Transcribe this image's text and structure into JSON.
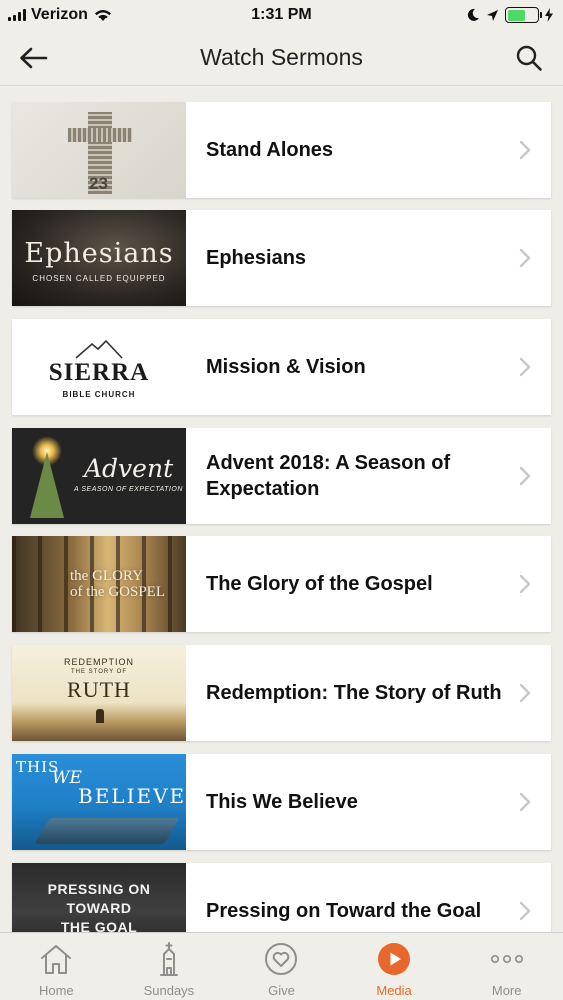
{
  "status_bar": {
    "carrier": "Verizon",
    "time": "1:31 PM",
    "battery_level": 0.6
  },
  "nav": {
    "title": "Watch Sermons"
  },
  "sermons": [
    {
      "title": "Stand Alones",
      "thumb_text": [
        "23"
      ]
    },
    {
      "title": "Ephesians",
      "thumb_text": [
        "Ephesians",
        "CHOSEN   CALLED   EQUIPPED"
      ]
    },
    {
      "title": "Mission & Vision",
      "thumb_text": [
        "SIERRA",
        "BIBLE CHURCH"
      ]
    },
    {
      "title": "Advent 2018: A Season of Expectation",
      "thumb_text": [
        "Advent",
        "A SEASON OF EXPECTATION"
      ]
    },
    {
      "title": "The Glory of the Gospel",
      "thumb_text": [
        "the GLORY",
        "of the GOSPEL"
      ]
    },
    {
      "title": "Redemption: The Story of Ruth",
      "thumb_text": [
        "REDEMPTION",
        "THE STORY OF",
        "RUTH"
      ]
    },
    {
      "title": "This We Believe",
      "thumb_text": [
        "THIS",
        "WE",
        "BELIEVE"
      ]
    },
    {
      "title": "Pressing on Toward the Goal",
      "thumb_text": [
        "PRESSING ON",
        "TOWARD",
        "THE GOAL"
      ]
    }
  ],
  "tabs": [
    {
      "label": "Home",
      "icon": "home-icon"
    },
    {
      "label": "Sundays",
      "icon": "church-icon"
    },
    {
      "label": "Give",
      "icon": "heart-icon"
    },
    {
      "label": "Media",
      "icon": "play-icon",
      "active": true
    },
    {
      "label": "More",
      "icon": "more-icon"
    }
  ],
  "colors": {
    "accent": "#e8672c",
    "background": "#eeede8",
    "battery": "#4cd964"
  }
}
